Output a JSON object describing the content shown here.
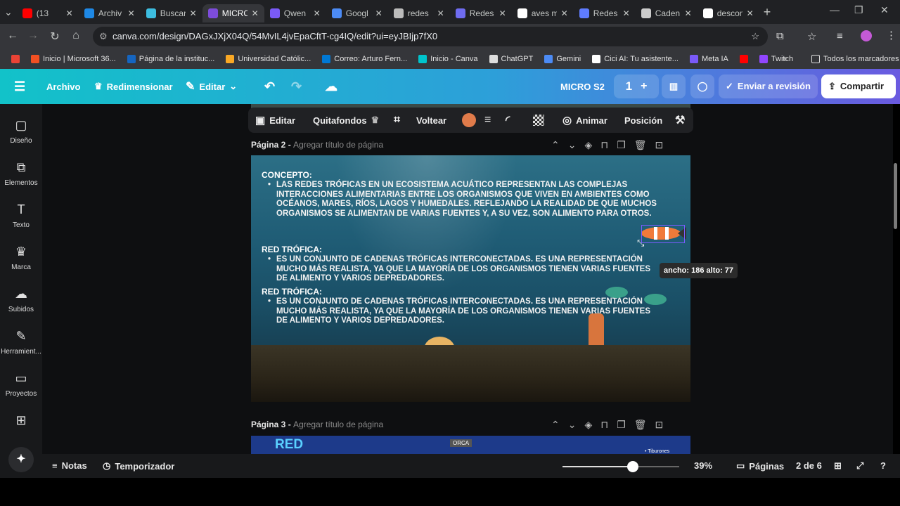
{
  "browser": {
    "tabs": [
      {
        "label": "(13",
        "color": "#ff0000"
      },
      {
        "label": "Archiv",
        "color": "#1e88e5"
      },
      {
        "label": "Buscar",
        "color": "#3dbde0"
      },
      {
        "label": "MICRO",
        "color": "#7d4cdb",
        "active": true
      },
      {
        "label": "Qwen",
        "color": "#7a5af8"
      },
      {
        "label": "Googl",
        "color": "#4c8bf5"
      },
      {
        "label": "redes",
        "color": "#bbbbbb"
      },
      {
        "label": "Redes",
        "color": "#6f6cf0"
      },
      {
        "label": "aves m",
        "color": "#ffffff"
      },
      {
        "label": "Redes",
        "color": "#5f7cff"
      },
      {
        "label": "Caden",
        "color": "#cccccc"
      },
      {
        "label": "descon",
        "color": "#ffffff"
      }
    ],
    "url": "canva.com/design/DAGxJXjX04Q/54MvIL4jvEpaCftT-cg4IQ/edit?ui=eyJBIjp7fX0",
    "bookmarks": [
      {
        "label": "",
        "color": "#ea4335"
      },
      {
        "label": "Inicio | Microsoft 36...",
        "color": "#f25022"
      },
      {
        "label": "Página de la instituc...",
        "color": "#1565c0"
      },
      {
        "label": "Universidad Católic...",
        "color": "#f9a825"
      },
      {
        "label": "Correo: Arturo Fern...",
        "color": "#0078d4"
      },
      {
        "label": "Inicio - Canva",
        "color": "#00c4cc"
      },
      {
        "label": "ChatGPT",
        "color": "#dddddd"
      },
      {
        "label": "Gemini",
        "color": "#4c8bf5"
      },
      {
        "label": "Cici AI: Tu asistente...",
        "color": "#ffffff"
      },
      {
        "label": "Meta IA",
        "color": "#7a5af8"
      },
      {
        "label": "",
        "color": "#ff0000"
      },
      {
        "label": "Twitch",
        "color": "#9146ff"
      }
    ],
    "bookmarks_all": "Todos los marcadores"
  },
  "canva": {
    "archivo": "Archivo",
    "redimensionar": "Redimensionar",
    "editar": "Editar",
    "title": "MICRO S2",
    "collab_count": "1",
    "enviar": "Enviar a revisión",
    "compartir": "Compartir"
  },
  "sidebar": [
    {
      "icon": "▢",
      "label": "Diseño"
    },
    {
      "icon": "⧉",
      "label": "Elementos"
    },
    {
      "icon": "T",
      "label": "Texto"
    },
    {
      "icon": "♛",
      "label": "Marca"
    },
    {
      "icon": "☁",
      "label": "Subidos"
    },
    {
      "icon": "✎",
      "label": "Herramient..."
    },
    {
      "icon": "▭",
      "label": "Proyectos"
    },
    {
      "icon": "⊞",
      "label": ""
    }
  ],
  "toolbar": {
    "editar": "Editar",
    "quitafondos": "Quitafondos",
    "voltear": "Voltear",
    "animar": "Animar",
    "posicion": "Posición",
    "swatch": "#e07b4a"
  },
  "page2": {
    "label": "Página 2 - ",
    "hint": "Agregar título de página"
  },
  "page3": {
    "label": "Página 3 - ",
    "hint": "Agregar título de página"
  },
  "slide": {
    "concepto_head": "CONCEPTO:",
    "concepto_body": "LAS REDES TRÓFICAS EN UN ECOSISTEMA ACUÁTICO REPRESENTAN LAS COMPLEJAS INTERACCIONES ALIMENTARIAS ENTRE LOS ORGANISMOS QUE VIVEN EN AMBIENTES COMO OCÉANOS, MARES, RÍOS, LAGOS Y HUMEDALES. REFLEJANDO LA REALIDAD DE QUE MUCHOS ORGANISMOS SE ALIMENTAN DE VARIAS FUENTES Y, A SU VEZ, SON ALIMENTO PARA OTROS.",
    "red1_head": "RED TRÓFICA:",
    "red1_body": "ES UN CONJUNTO DE CADENAS TRÓFICAS INTERCONECTADAS. ES UNA REPRESENTACIÓN MUCHO MÁS REALISTA, YA QUE LA MAYORÍA DE LOS ORGANISMOS TIENEN VARIAS FUENTES DE ALIMENTO Y VARIOS DEPREDADORES.",
    "red2_head": "RED TRÓFICA:",
    "red2_body": "ES UN CONJUNTO DE CADENAS TRÓFICAS INTERCONECTADAS. ES UNA REPRESENTACIÓN MUCHO MÁS REALISTA, YA QUE LA MAYORÍA DE LOS ORGANISMOS TIENEN VARIAS FUENTES DE ALIMENTO Y VARIOS DEPREDADORES."
  },
  "tooltip": "ancho: 186 alto: 77",
  "slide3": {
    "title": "RED",
    "label": "ORCA",
    "side": "Tiburones"
  },
  "bottom": {
    "notas": "Notas",
    "temporizador": "Temporizador",
    "zoom": "39%",
    "zoom_level": 0.39,
    "paginas": "Páginas",
    "page_count": "2 de 6"
  }
}
